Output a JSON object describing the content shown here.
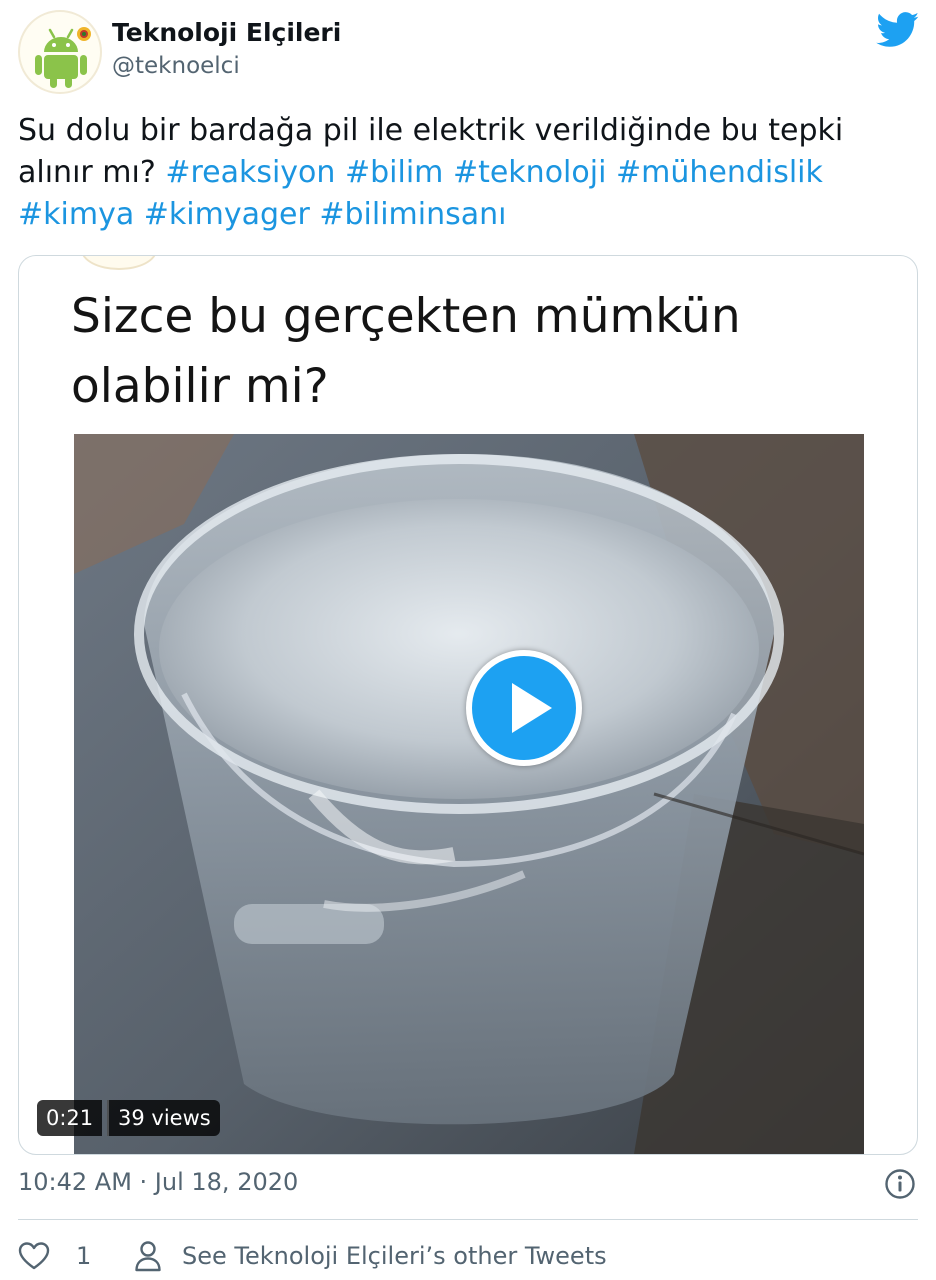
{
  "author": {
    "display_name": "Teknoloji Elçileri",
    "handle": "@teknoelci",
    "avatar_icon": "android-robot-icon"
  },
  "brand": {
    "icon": "twitter-bird-icon",
    "color": "#1da1f2"
  },
  "tweet": {
    "text_plain": "Su dolu bir bardağa pil ile elektrik verildiğinde bu tepki alınır mı?",
    "hashtags": [
      "#reaksiyon",
      "#bilim",
      "#teknoloji",
      "#mühendislik",
      "#kimya",
      "#kimyager",
      "#biliminsanı"
    ],
    "hashtag_color": "#1b95e0"
  },
  "media": {
    "caption": "Sizce bu gerçekten mümkün olabilir mi?",
    "duration": "0:21",
    "views": "39 views",
    "play_icon": "play-icon"
  },
  "meta": {
    "timestamp": "10:42 AM · Jul 18, 2020",
    "info_icon": "info-icon"
  },
  "actions": {
    "like_count": "1",
    "like_icon": "heart-icon",
    "other_tweets_label": "See Teknoloji Elçileri’s other Tweets",
    "other_tweets_icon": "person-icon"
  }
}
